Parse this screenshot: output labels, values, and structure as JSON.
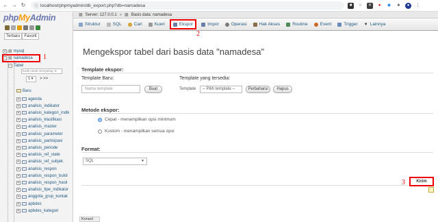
{
  "browser": {
    "url": "localhost/phpmyadmin/db_export.php?db=namadesa"
  },
  "sidebar": {
    "logo": {
      "php": "php",
      "my": "My",
      "admin": "Admin"
    },
    "tabs": [
      "Terbaru",
      "Favorit"
    ],
    "tree": {
      "mysql": "mysql",
      "namadesa": "namadesa",
      "tabel": "Tabel",
      "filter_placeholder": "Ketik untuk menyaring, E",
      "page": "1",
      "page_nav": "> >>",
      "baru": "Baru",
      "tables": [
        "agenda",
        "analisis_indikator",
        "analisis_kategori_indik",
        "analisis_klasifikasi",
        "analisis_master",
        "analisis_parameter",
        "analisis_partisipasi",
        "analisis_periode",
        "analisis_ref_state",
        "analisis_ref_subjek",
        "analisis_respon",
        "analisis_respon_bukti",
        "analisis_respon_hasil",
        "analisis_tipe_indikator",
        "anggota_grup_kontak",
        "apbdes",
        "apbdes_kategori"
      ]
    }
  },
  "breadcrumb": {
    "server": "Server: 127.0.0.1",
    "database": "Basis data: namadesa"
  },
  "tabs": [
    {
      "label": "Struktur"
    },
    {
      "label": "SQL"
    },
    {
      "label": "Cari"
    },
    {
      "label": "Kueri"
    },
    {
      "label": "Ekspor",
      "active": true
    },
    {
      "label": "Impor"
    },
    {
      "label": "Operasi"
    },
    {
      "label": "Hak Akses"
    },
    {
      "label": "Routine"
    },
    {
      "label": "Event"
    },
    {
      "label": "Trigger"
    },
    {
      "label": "Lainnya"
    }
  ],
  "main": {
    "heading": "Mengekspor tabel dari basis data \"namadesa\"",
    "template_ekspor": {
      "title": "Template ekspor:",
      "new_label": "Template Baru:",
      "name_placeholder": "Nama template",
      "create_btn": "Buat",
      "existing_label": "Template yang tersedia:",
      "template_label": "Template",
      "select_value": "-- Pilih template --",
      "update_btn": "Perbaharui",
      "delete_btn": "Hapus"
    },
    "metode": {
      "title": "Metode ekspor:",
      "quick": "Cepat - menampilkan opsi minimum",
      "custom": "Kustom - menampilkan semua opsi"
    },
    "format": {
      "title": "Format:",
      "value": "SQL"
    },
    "go_btn": "Kirim",
    "console": "Konsol"
  },
  "annotations": {
    "one": "1",
    "two": "2",
    "three": "3"
  }
}
